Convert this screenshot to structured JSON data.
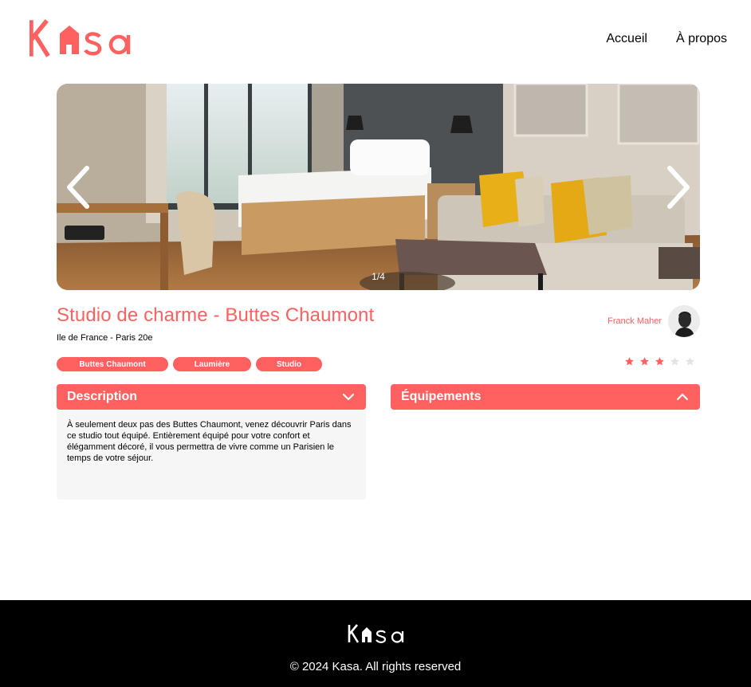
{
  "brand": {
    "logo_text": "Kasa",
    "accent_color": "#FF6060"
  },
  "nav": {
    "items": [
      {
        "label": "Accueil"
      },
      {
        "label": "À propos"
      }
    ]
  },
  "carousel": {
    "counter": "1/4",
    "prev_icon": "chevron-left-icon",
    "next_icon": "chevron-right-icon"
  },
  "listing": {
    "title": "Studio de charme - Buttes Chaumont",
    "location": "Ile de France - Paris 20e",
    "tags": [
      "Buttes Chaumont",
      "Laumière",
      "Studio"
    ],
    "host_name": "Franck Maher",
    "rating": 3,
    "rating_max": 5
  },
  "collapses": {
    "description": {
      "title": "Description",
      "open": true,
      "text": "À seulement deux pas des Buttes Chaumont, venez découvrir Paris dans ce studio tout équipé. Entièrement équipé pour votre confort et élégamment décoré, il vous permettra de vivre comme un Parisien le temps de votre séjour."
    },
    "equipments": {
      "title": "Équipements",
      "open": false
    }
  },
  "footer": {
    "logo_text": "Kasa",
    "copyright": "© 2024 Kasa. All rights reserved"
  }
}
